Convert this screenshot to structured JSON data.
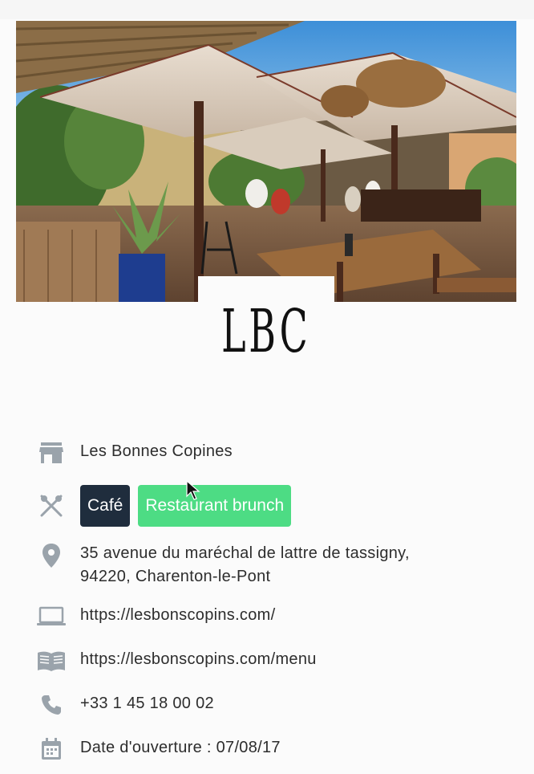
{
  "logo": {
    "text": "LBC"
  },
  "hero": {
    "icon": "restaurant-terrace-photo"
  },
  "venue": {
    "name": "Les Bonnes Copines",
    "name_icon": "storefront-icon",
    "category_icon": "utensils-icon",
    "tags": [
      {
        "label": "Café",
        "color": "#1f2d3d"
      },
      {
        "label": "Restaurant brunch",
        "color": "#4ddc84"
      }
    ],
    "address_line1": "35 avenue du maréchal de lattre de tassigny,",
    "address_line2": "94220, Charenton-le-Pont",
    "address_icon": "map-pin-icon",
    "website": "https://lesbonscopins.com/",
    "website_icon": "laptop-icon",
    "menu": "https://lesbonscopins.com/menu",
    "menu_icon": "open-book-icon",
    "phone": "+33 1 45 18 00 02",
    "phone_icon": "phone-icon",
    "opening_date": "Date d'ouverture : 07/08/17",
    "opening_icon": "calendar-icon"
  },
  "colors": {
    "icon_gray": "#9aa3ab",
    "tag_dark": "#1f2d3d",
    "tag_green": "#4ddc84"
  }
}
